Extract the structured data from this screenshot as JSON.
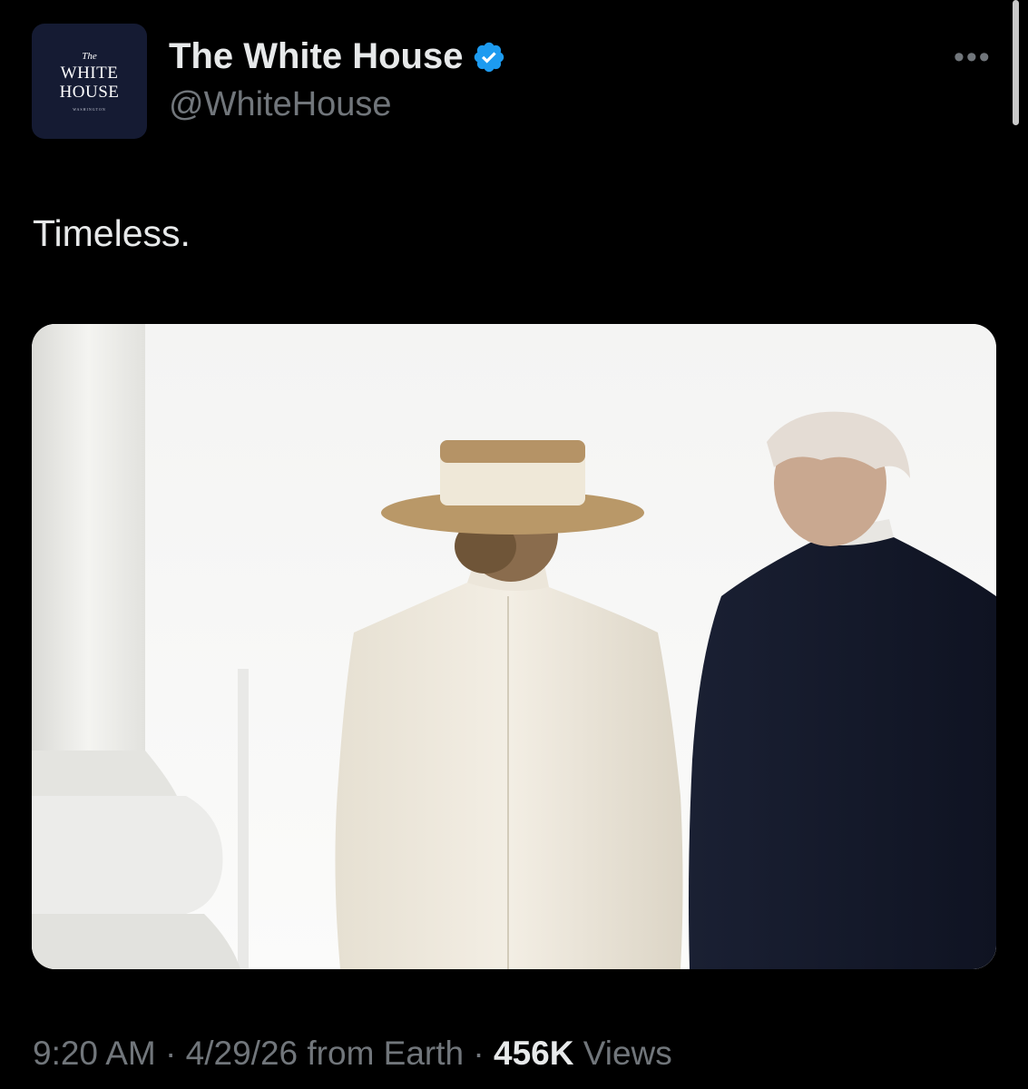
{
  "account": {
    "avatar_the": "The",
    "avatar_line1": "WHITE",
    "avatar_line2": "HOUSE",
    "avatar_sub": "WASHINGTON",
    "display_name": "The White House",
    "handle": "@WhiteHouse",
    "verified_icon": "verified-badge-icon",
    "verified_color": "#1d9bf0"
  },
  "more_icon": "more-options-icon",
  "tweet": {
    "text": "Timeless."
  },
  "meta": {
    "time": "9:20 AM",
    "separator": "·",
    "date": "4/29/26",
    "from": "from Earth",
    "views_count": "456K",
    "views_label": "Views"
  },
  "colors": {
    "background": "#000000",
    "primary_text": "#e7e9ea",
    "secondary_text": "#71767b",
    "avatar_bg": "#151b33"
  }
}
